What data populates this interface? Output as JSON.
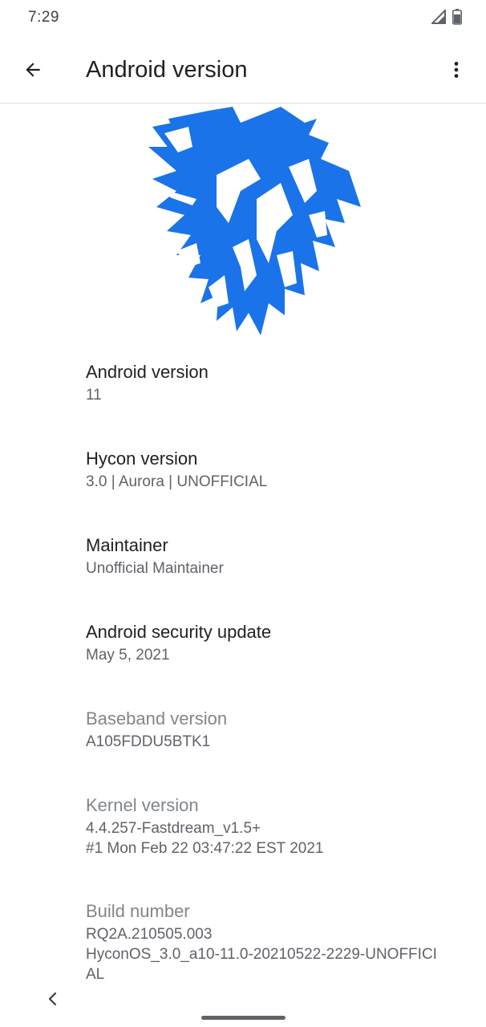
{
  "status_bar": {
    "time": "7:29",
    "icons": [
      "signal-icon",
      "battery-icon"
    ]
  },
  "app_bar": {
    "title": "Android version",
    "back_icon": "arrow-back-icon",
    "overflow_icon": "more-vert-icon"
  },
  "logo": {
    "icon": "wolf-logo",
    "color": "#1a73e8"
  },
  "items": [
    {
      "title": "Android version",
      "summary": "11",
      "enabled": true
    },
    {
      "title": "Hycon version",
      "summary": "3.0 | Aurora | UNOFFICIAL",
      "enabled": true
    },
    {
      "title": "Maintainer",
      "summary": "Unofficial Maintainer",
      "enabled": true
    },
    {
      "title": "Android security update",
      "summary": "May 5, 2021",
      "enabled": true
    },
    {
      "title": "Baseband version",
      "summary": "A105FDDU5BTK1",
      "enabled": false
    },
    {
      "title": "Kernel version",
      "summary_lines": [
        "4.4.257-Fastdream_v1.5+",
        "#1 Mon Feb 22 03:47:22 EST 2021"
      ],
      "enabled": false
    },
    {
      "title": "Build number",
      "summary_lines": [
        "RQ2A.210505.003",
        "HyconOS_3.0_a10-11.0-20210522-2229-UNOFFICI",
        "AL"
      ],
      "enabled": false
    }
  ],
  "nav_bar": {
    "back_icon": "nav-back-chevron-icon",
    "handle": "gesture-handle"
  }
}
